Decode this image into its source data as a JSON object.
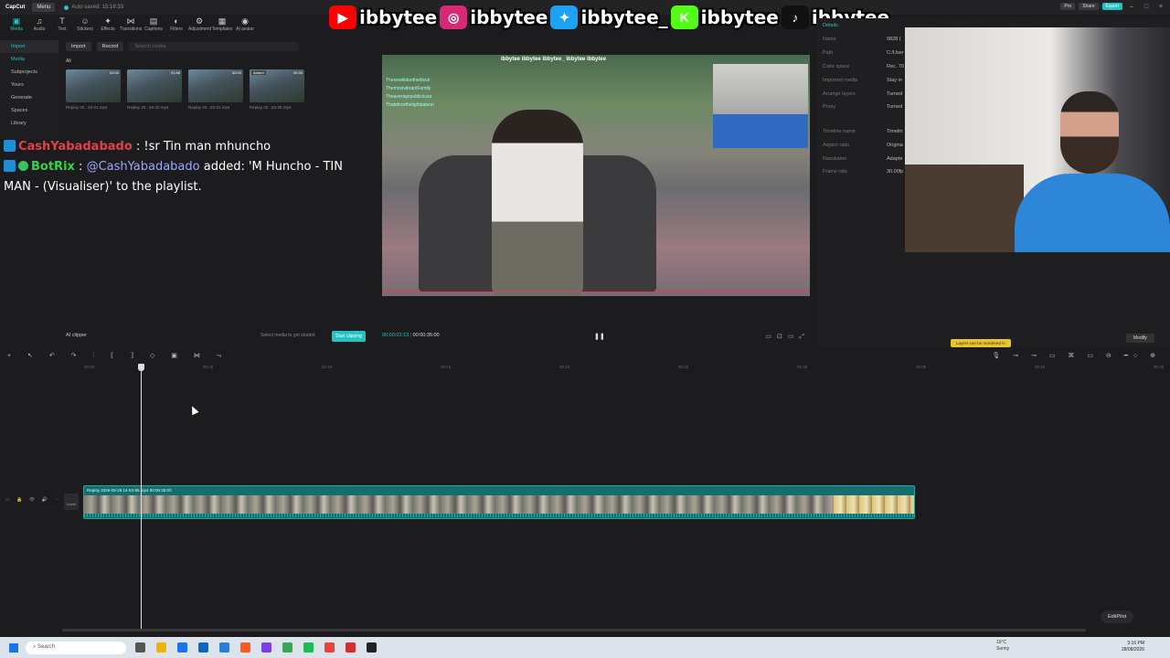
{
  "titlebar": {
    "app": "CapCut",
    "menu": "Menu",
    "autosave": "Auto saved: 15:16:33",
    "pro": "Pro",
    "share": "Share",
    "export": "Export"
  },
  "socials": {
    "handles": [
      "ibbytee",
      "ibbytee",
      "ibbytee_",
      "ibbytee",
      "ibbytee"
    ],
    "platforms": [
      "youtube-icon",
      "instagram-icon",
      "twitter-icon",
      "kick-icon",
      "tiktok-icon"
    ],
    "colors": [
      "#ff0000",
      "#d62976",
      "#1da1f2",
      "#53fc18",
      "#111111"
    ]
  },
  "tools": [
    {
      "label": "Media",
      "icon": "media-icon"
    },
    {
      "label": "Audio",
      "icon": "audio-icon"
    },
    {
      "label": "Text",
      "icon": "text-icon"
    },
    {
      "label": "Stickers",
      "icon": "stickers-icon"
    },
    {
      "label": "Effects",
      "icon": "effects-icon"
    },
    {
      "label": "Transitions",
      "icon": "transitions-icon"
    },
    {
      "label": "Captions",
      "icon": "captions-icon"
    },
    {
      "label": "Filters",
      "icon": "filters-icon"
    },
    {
      "label": "Adjustment",
      "icon": "adjustment-icon"
    },
    {
      "label": "Templates",
      "icon": "templates-icon"
    },
    {
      "label": "AI avatar",
      "icon": "ai-avatar-icon"
    }
  ],
  "leftnav": [
    "Import",
    "Media",
    "Subprojects",
    "Yours",
    "Generate",
    "Spaces",
    "Library"
  ],
  "media": {
    "import": "Import",
    "record": "Record",
    "search_placeholder": "Search media",
    "filter": "All",
    "thumbs": [
      {
        "name": "Replay 20...49-01.mp4",
        "dur": "02:00",
        "added": ""
      },
      {
        "name": "Replay 20...49-32.mp4",
        "dur": "01:56",
        "added": ""
      },
      {
        "name": "Replay 20...52-01.mp4",
        "dur": "02:00",
        "added": ""
      },
      {
        "name": "Replay 20...53-55.mp4",
        "dur": "00:35",
        "added": "Added"
      }
    ],
    "ai_clipper": "AI clipper",
    "select_hint": "Select media to get started",
    "start_clipping": "Start clipping"
  },
  "chat": [
    {
      "user": "CashYabadabado",
      "text": " : !sr Tin man mhuncho"
    },
    {
      "user": "BotRix",
      "mention": "@CashYabadabado",
      "text": " added: 'M Huncho - TIN MAN - (Visualiser)' to the playlist."
    }
  ],
  "player": {
    "current": "00:00:02:13",
    "total": "00:00:35:00",
    "mini_banner": "ibbytee ibbytee ibbytee_ ibbytee ibbytee",
    "mini_chat": [
      "Thenewkidontheblock",
      "ThemostvibrantFamily",
      "Theaveragepublickusa",
      "Thatshowthelightpaleon"
    ]
  },
  "details": {
    "title": "Details",
    "rows": [
      {
        "k": "Name",
        "v": "0828 ("
      },
      {
        "k": "Path",
        "v": "C:/User"
      },
      {
        "k": "Color space",
        "v": "Rec. 70"
      },
      {
        "k": "Imported media",
        "v": "Stay in"
      },
      {
        "k": "Arrange layers",
        "v": "Turned"
      },
      {
        "k": "Proxy",
        "v": "Turned"
      }
    ],
    "rows2": [
      {
        "k": "Timeline name",
        "v": "Timelin"
      },
      {
        "k": "Aspect ratio",
        "v": "Origina"
      },
      {
        "k": "Resolution",
        "v": "Adapte"
      },
      {
        "k": "Frame rate",
        "v": "30.00fp"
      }
    ],
    "modify": "Modify",
    "notice": "Layers can be reordered in"
  },
  "timeline": {
    "ticks": [
      "00:00",
      "00:05",
      "00:10",
      "00:15",
      "00:20",
      "00:25",
      "00:30",
      "00:35",
      "00:40",
      "00:45"
    ],
    "clip_label": "Replay 2026-08-28 14-53-55.mp4   00:00:35:00",
    "cover": "Cover",
    "editpilot": "EditPilot"
  },
  "taskbar": {
    "search": "Search",
    "weather_temp": "16°C",
    "weather_desc": "Sunny",
    "time": "3:16 PM",
    "date": "28/08/2026"
  }
}
